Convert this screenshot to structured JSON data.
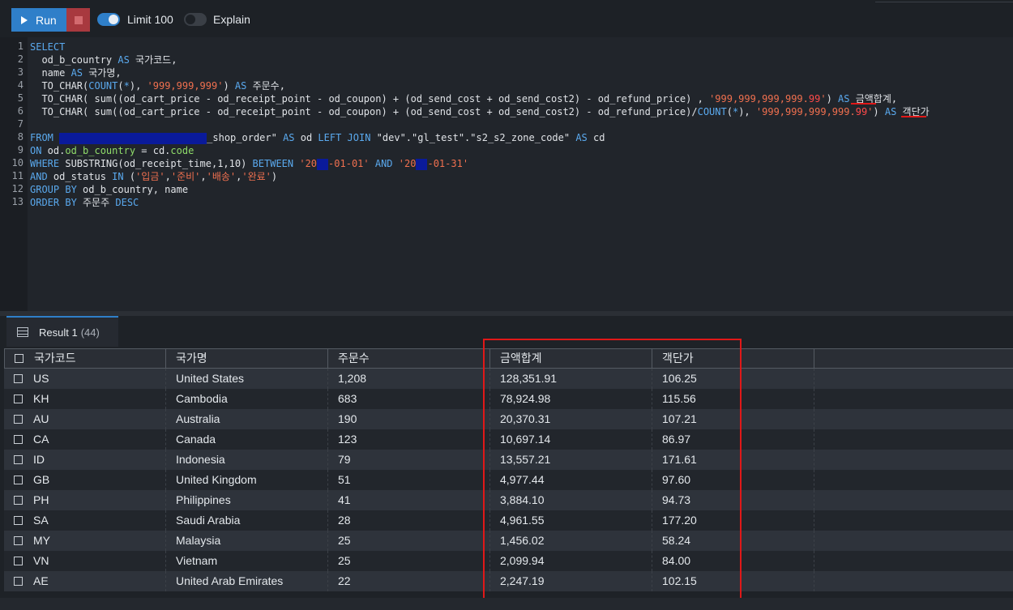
{
  "toolbar": {
    "run_label": "Run",
    "limit_label": "Limit 100",
    "explain_label": "Explain"
  },
  "editor": {
    "line_numbers": [
      "1",
      "2",
      "3",
      "4",
      "5",
      "6",
      "7",
      "8",
      "9",
      "10",
      "11",
      "12",
      "13"
    ]
  },
  "results": {
    "tab_label": "Result 1",
    "tab_count": "(44)",
    "columns": [
      "국가코드",
      "국가명",
      "주문수",
      "금액합계",
      "객단가"
    ],
    "rows": [
      [
        "US",
        "United States",
        "1,208",
        "128,351.91",
        "106.25"
      ],
      [
        "KH",
        "Cambodia",
        "683",
        "78,924.98",
        "115.56"
      ],
      [
        "AU",
        "Australia",
        "190",
        "20,370.31",
        "107.21"
      ],
      [
        "CA",
        "Canada",
        "123",
        "10,697.14",
        "86.97"
      ],
      [
        "ID",
        "Indonesia",
        "79",
        "13,557.21",
        "171.61"
      ],
      [
        "GB",
        "United Kingdom",
        "51",
        "4,977.44",
        "97.60"
      ],
      [
        "PH",
        "Philippines",
        "41",
        "3,884.10",
        "94.73"
      ],
      [
        "SA",
        "Saudi Arabia",
        "28",
        "4,961.55",
        "177.20"
      ],
      [
        "MY",
        "Malaysia",
        "25",
        "1,456.02",
        "58.24"
      ],
      [
        "VN",
        "Vietnam",
        "25",
        "2,099.94",
        "84.00"
      ],
      [
        "AE",
        "United Arab Emirates",
        "22",
        "2,247.19",
        "102.15"
      ]
    ]
  },
  "colors": {
    "accent": "#2f7fc9",
    "stop": "#a8393f",
    "highlight": "#e01818"
  }
}
